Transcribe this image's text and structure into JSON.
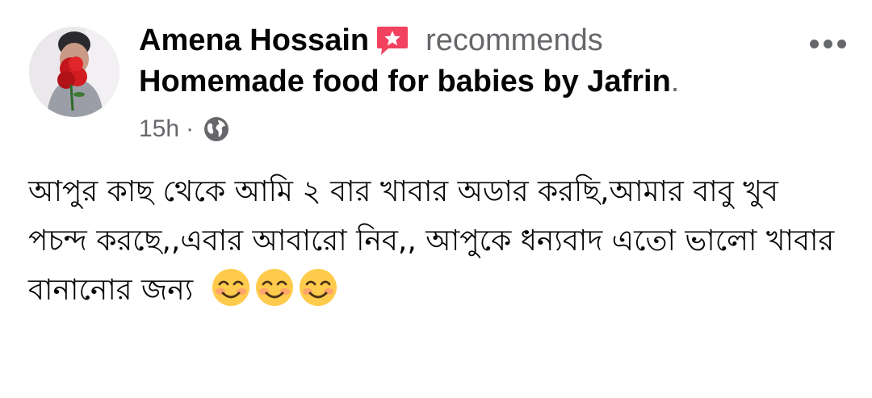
{
  "post": {
    "author": "Amena Hossain",
    "action": "recommends",
    "page_name": "Homemade food for babies by Jafrin",
    "page_suffix": ".",
    "time": "15h",
    "separator": "·",
    "audience_icon": "globe-icon",
    "recommend_icon": "recommend-star-icon",
    "more_icon": "more-options-icon",
    "body": "আপুর কাছ থেকে আমি ২ বার খাবার অডার করছি,আমার বাবু খুব পচন্দ করছে,,এবার আবারো নিব,, আপুকে ধন্যবাদ এতো ভালো খাবার বানানোর জন্য",
    "emojis": [
      "😊",
      "😊",
      "😊"
    ]
  },
  "colors": {
    "text_primary": "#050505",
    "text_secondary": "#65676b",
    "recommend_badge": "#f3425f"
  }
}
